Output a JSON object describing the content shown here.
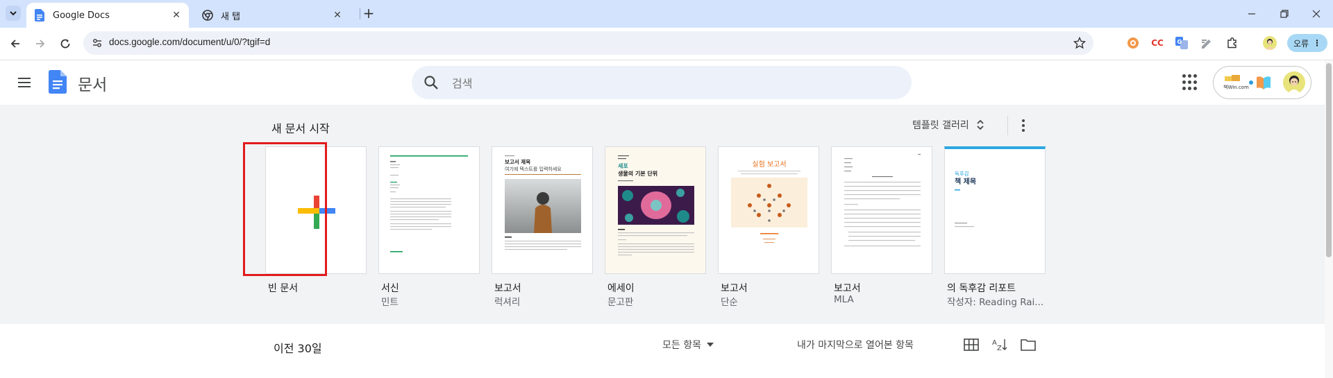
{
  "browser": {
    "tabs": [
      {
        "title": "Google Docs",
        "active": true
      },
      {
        "title": "새 탭",
        "active": false
      }
    ],
    "url": "docs.google.com/document/u/0/?tgif=d",
    "error_button_label": "오류",
    "extension_cc_label": "CC"
  },
  "header": {
    "app_title": "문서",
    "search_placeholder": "검색",
    "account_logo_text": "책Win.com"
  },
  "gallery": {
    "heading": "새 문서 시작",
    "gallery_link": "템플릿 갤러리",
    "templates": [
      {
        "title": "빈 문서",
        "subtitle": ""
      },
      {
        "title": "서신",
        "subtitle": "민트"
      },
      {
        "title": "보고서",
        "subtitle": "럭셔리"
      },
      {
        "title": "에세이",
        "subtitle": "문고판"
      },
      {
        "title": "보고서",
        "subtitle": "단순"
      },
      {
        "title": "보고서",
        "subtitle": "MLA"
      },
      {
        "title": "의 독후감 리포트",
        "subtitle": "작성자: Reading Rai..."
      }
    ],
    "previews": {
      "luxury_title": "보고서 제목",
      "luxury_subtitle": "여기에 텍스트를 입력하세요",
      "essay_title_1": "세포",
      "essay_title_2": "생물의 기본 단위",
      "simple_title": "실험 보고서",
      "book_label": "독후감",
      "book_title": "책 제목"
    }
  },
  "recent": {
    "title": "이전 30일",
    "owner_filter": "모든 항목",
    "sort_label": "내가 마지막으로 열어본 항목"
  },
  "colors": {
    "tabstrip": "#d3e3fd",
    "docs_blue": "#4285f4",
    "gallery_bg": "#f1f3f4",
    "highlight": "#e21b1b"
  }
}
